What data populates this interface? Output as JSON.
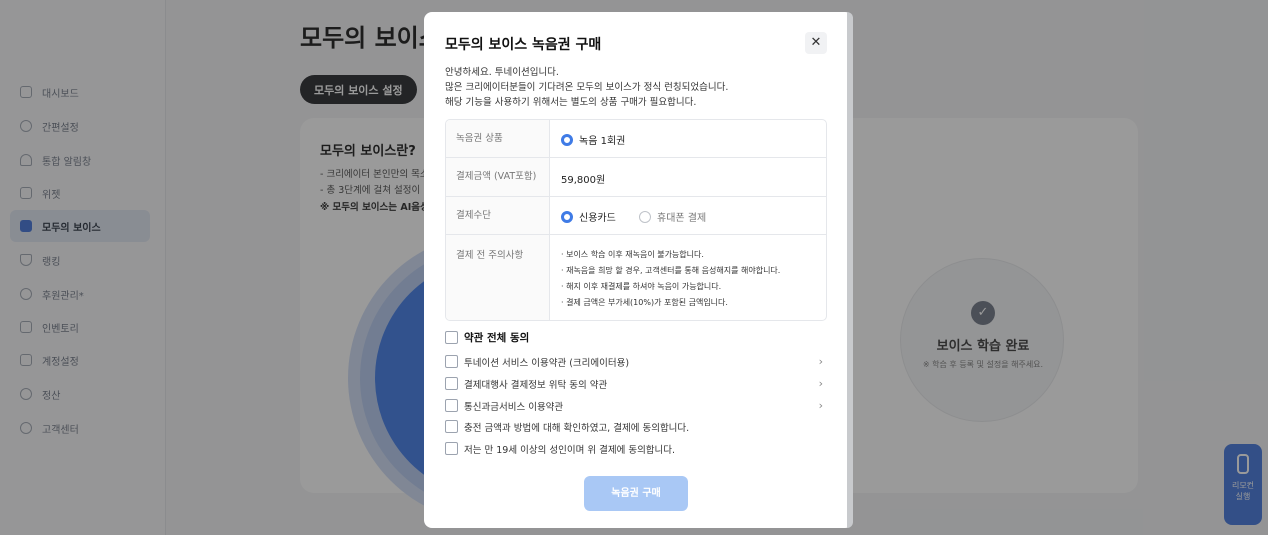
{
  "sidebar": {
    "items": [
      {
        "label": "대시보드",
        "icon": "dashboard-icon"
      },
      {
        "label": "간편설정",
        "icon": "gear-icon"
      },
      {
        "label": "통합 알림창",
        "icon": "bell-icon"
      },
      {
        "label": "위젯",
        "icon": "widget-icon"
      },
      {
        "label": "모두의 보이스",
        "icon": "voice-icon",
        "active": true
      },
      {
        "label": "랭킹",
        "icon": "trophy-icon"
      },
      {
        "label": "후원관리*",
        "icon": "donation-icon"
      },
      {
        "label": "인벤토리",
        "icon": "inventory-icon"
      },
      {
        "label": "계정설정",
        "icon": "account-icon"
      },
      {
        "label": "정산",
        "icon": "settlement-icon"
      },
      {
        "label": "고객센터",
        "icon": "headset-icon"
      }
    ]
  },
  "main": {
    "title": "모두의 보이스",
    "tab_label": "모두의 보이스 설정",
    "card": {
      "title": "모두의 보이스란?",
      "line1": "- 크리에이터 본인만의 목소",
      "line2": "- 총 3단계에 걸쳐 설정이",
      "line3": "※ 모두의 보이스는 AI음성"
    },
    "done": {
      "check": "✓",
      "title": "보이스 학습 완료",
      "subtitle": "※ 학습 후 등록 및 설정을 해주세요."
    }
  },
  "remote": {
    "label_line1": "리모컨",
    "label_line2": "실행"
  },
  "modal": {
    "title": "모두의 보이스 녹음권 구매",
    "close_glyph": "✕",
    "intro": [
      "안녕하세요. 투네이션입니다.",
      "많은 크리에이터분들이 기다려온 모두의 보이스가 정식 런칭되었습니다.",
      "해당 기능을 사용하기 위해서는 별도의 상품 구매가 필요합니다."
    ],
    "table": {
      "product_label": "녹음권 상품",
      "product_value": "녹음 1회권",
      "price_label": "결제금액 (VAT포함)",
      "price_value": "59,800원",
      "method_label": "결제수단",
      "method_card": "신용카드",
      "method_phone": "휴대폰 결제",
      "notice_label": "결제 전 주의사항",
      "notices": [
        "· 보이스 학습 이후 재녹음이 불가능합니다.",
        "· 재녹음을 희망 할 경우, 고객센터를 통해 음성해지를 해야합니다.",
        "· 해지 이후 재결제를 하셔야 녹음이 가능합니다.",
        "· 결제 금액은 부가세(10%)가 포함된 금액입니다."
      ]
    },
    "agreements": {
      "all": "약관 전체 동의",
      "items": [
        "투네이션 서비스 이용약관 (크리에이터용)",
        "결제대행사 결제정보 위탁 동의 약관",
        "통신과금서비스 이용약관",
        "충전 금액과 방법에 대해 확인하였고, 결제에 동의합니다.",
        "저는 만 19세 이상의 성인이며 위 결제에 동의합니다."
      ],
      "chevron": "›"
    },
    "buy_button": "녹음권 구매"
  },
  "colors": {
    "accent": "#3f7be6",
    "button_disabled": "#a9c8f5",
    "overlay": "rgba(40,40,40,0.47)"
  }
}
